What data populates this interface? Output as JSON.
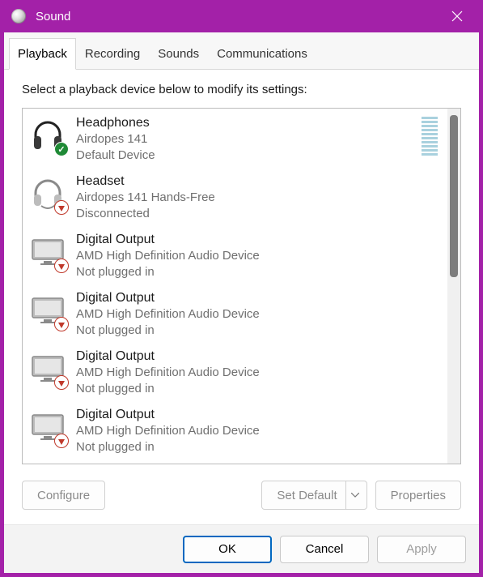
{
  "titlebar": {
    "title": "Sound"
  },
  "tabs": [
    {
      "label": "Playback",
      "active": true
    },
    {
      "label": "Recording",
      "active": false
    },
    {
      "label": "Sounds",
      "active": false
    },
    {
      "label": "Communications",
      "active": false
    }
  ],
  "instruction": "Select a playback device below to modify its settings:",
  "devices": [
    {
      "name": "Headphones",
      "desc": "Airdopes 141",
      "status": "Default Device",
      "icon": "headphones",
      "badge": "ok",
      "meter": true,
      "active": true
    },
    {
      "name": "Headset",
      "desc": "Airdopes 141 Hands-Free",
      "status": "Disconnected",
      "icon": "headset",
      "badge": "unplug",
      "meter": false,
      "active": false
    },
    {
      "name": "Digital Output",
      "desc": "AMD High Definition Audio Device",
      "status": "Not plugged in",
      "icon": "monitor",
      "badge": "unplug",
      "meter": false,
      "active": false
    },
    {
      "name": "Digital Output",
      "desc": "AMD High Definition Audio Device",
      "status": "Not plugged in",
      "icon": "monitor",
      "badge": "unplug",
      "meter": false,
      "active": false
    },
    {
      "name": "Digital Output",
      "desc": "AMD High Definition Audio Device",
      "status": "Not plugged in",
      "icon": "monitor",
      "badge": "unplug",
      "meter": false,
      "active": false
    },
    {
      "name": "Digital Output",
      "desc": "AMD High Definition Audio Device",
      "status": "Not plugged in",
      "icon": "monitor",
      "badge": "unplug",
      "meter": false,
      "active": false
    }
  ],
  "buttons": {
    "configure": "Configure",
    "set_default": "Set Default",
    "properties": "Properties",
    "ok": "OK",
    "cancel": "Cancel",
    "apply": "Apply"
  }
}
